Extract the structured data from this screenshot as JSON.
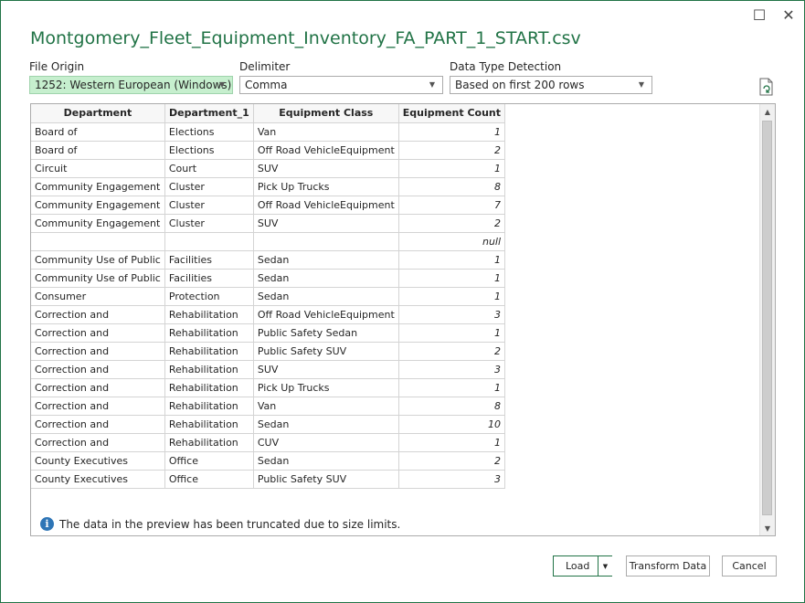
{
  "window": {
    "title": "Montgomery_Fleet_Equipment_Inventory_FA_PART_1_START.csv",
    "maximize_glyph": "☐",
    "close_glyph": "✕"
  },
  "options": {
    "file_origin": {
      "label": "File Origin",
      "value": "1252: Western European (Windows)"
    },
    "delimiter": {
      "label": "Delimiter",
      "value": "Comma"
    },
    "detection": {
      "label": "Data Type Detection",
      "value": "Based on first 200 rows"
    }
  },
  "preview": {
    "columns": [
      "Department",
      "Department_1",
      "Equipment Class",
      "Equipment Count"
    ],
    "rows": [
      [
        "Board of",
        "Elections",
        "Van",
        "1"
      ],
      [
        "Board of",
        "Elections",
        "Off Road VehicleEquipment",
        "2"
      ],
      [
        "Circuit",
        "Court",
        "SUV",
        "1"
      ],
      [
        "Community Engagement",
        "Cluster",
        "Pick Up Trucks",
        "8"
      ],
      [
        "Community Engagement",
        "Cluster",
        "Off Road VehicleEquipment",
        "7"
      ],
      [
        "Community Engagement",
        "Cluster",
        "SUV",
        "2"
      ],
      [
        "",
        "",
        "",
        "null"
      ],
      [
        "Community Use of Public",
        "Facilities",
        "Sedan",
        "1"
      ],
      [
        "Community Use of Public",
        "Facilities",
        "Sedan",
        "1"
      ],
      [
        "Consumer",
        "Protection",
        "Sedan",
        "1"
      ],
      [
        "Correction and",
        "Rehabilitation",
        "Off Road VehicleEquipment",
        "3"
      ],
      [
        "Correction and",
        "Rehabilitation",
        "Public Safety Sedan",
        "1"
      ],
      [
        "Correction and",
        "Rehabilitation",
        "Public Safety SUV",
        "2"
      ],
      [
        "Correction and",
        "Rehabilitation",
        "SUV",
        "3"
      ],
      [
        "Correction and",
        "Rehabilitation",
        "Pick Up Trucks",
        "1"
      ],
      [
        "Correction and",
        "Rehabilitation",
        "Van",
        "8"
      ],
      [
        "Correction and",
        "Rehabilitation",
        "Sedan",
        "10"
      ],
      [
        "Correction and",
        "Rehabilitation",
        "CUV",
        "1"
      ],
      [
        "County Executives",
        "Office",
        "Sedan",
        "2"
      ],
      [
        "County Executives",
        "Office",
        "Public Safety SUV",
        "3"
      ]
    ],
    "truncation_note": "The data in the preview has been truncated due to size limits."
  },
  "buttons": {
    "load": "Load",
    "transform": "Transform Data",
    "cancel": "Cancel"
  },
  "colors": {
    "accent": "#217346",
    "selected_fill": "#c6efce",
    "info_blue": "#2e75b6"
  }
}
